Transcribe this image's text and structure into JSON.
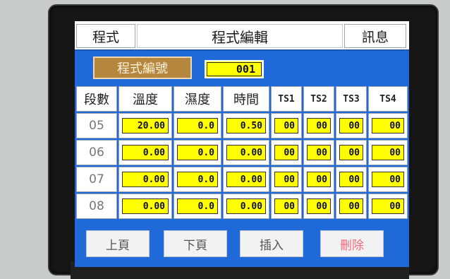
{
  "header": {
    "program_button": "程式",
    "title": "程式編輯",
    "message_button": "訊息"
  },
  "program": {
    "label": "程式編號",
    "number": "001"
  },
  "table": {
    "columns": [
      "段數",
      "溫度",
      "濕度",
      "時間",
      "TS1",
      "TS2",
      "TS3",
      "TS4"
    ],
    "rows": [
      {
        "segment": "05",
        "temperature": "20.00",
        "humidity": "0.0",
        "time": "0.50",
        "ts1": "00",
        "ts2": "00",
        "ts3": "00",
        "ts4": "00"
      },
      {
        "segment": "06",
        "temperature": "0.00",
        "humidity": "0.0",
        "time": "0.00",
        "ts1": "00",
        "ts2": "00",
        "ts3": "00",
        "ts4": "00"
      },
      {
        "segment": "07",
        "temperature": "0.00",
        "humidity": "0.0",
        "time": "0.00",
        "ts1": "00",
        "ts2": "00",
        "ts3": "00",
        "ts4": "00"
      },
      {
        "segment": "08",
        "temperature": "0.00",
        "humidity": "0.0",
        "time": "0.00",
        "ts1": "00",
        "ts2": "00",
        "ts3": "00",
        "ts4": "00"
      }
    ]
  },
  "footer": {
    "prev_page": "上頁",
    "next_page": "下頁",
    "insert": "插入",
    "delete": "刪除"
  },
  "colors": {
    "screen_background": "#1f69d9",
    "value_field": "#ffff00",
    "program_label": "#b4863e",
    "delete_text": "#ee6f7f"
  }
}
